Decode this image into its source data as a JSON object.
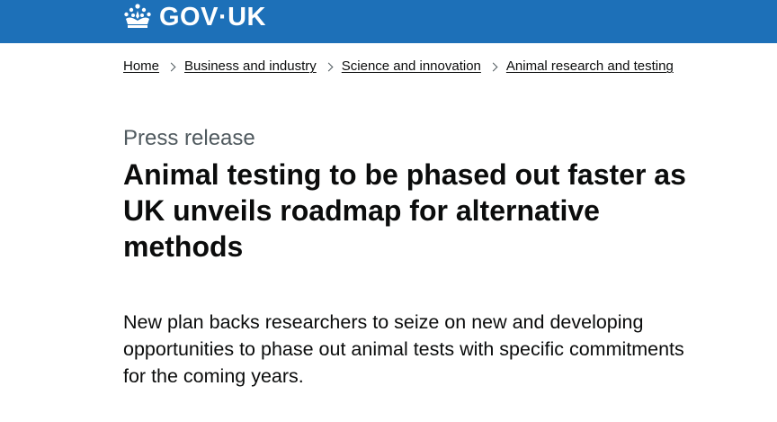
{
  "header": {
    "logo_text": "GOV·UK",
    "logo_icon": "crown-icon",
    "background_color": "#1d70b8"
  },
  "breadcrumbs": [
    {
      "label": "Home"
    },
    {
      "label": "Business and industry"
    },
    {
      "label": "Science and innovation"
    },
    {
      "label": "Animal research and testing"
    }
  ],
  "article": {
    "caption": "Press release",
    "title": "Animal testing to be phased out faster as UK unveils roadmap for alternative methods",
    "lead": "New plan backs researchers to seize on new and developing opportunities to phase out animal tests with specific commitments for the coming years."
  }
}
